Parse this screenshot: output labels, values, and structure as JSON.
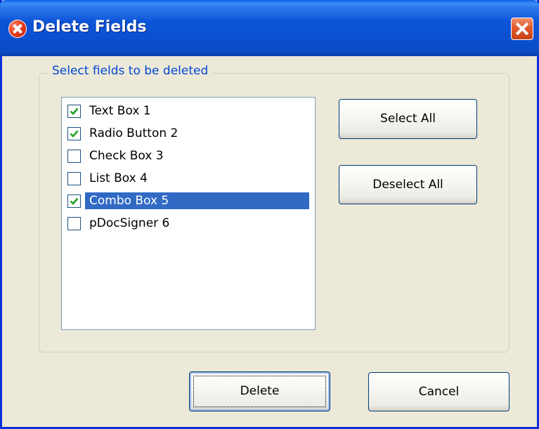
{
  "window": {
    "title": "Delete Fields"
  },
  "group": {
    "legend": "Select fields to be deleted"
  },
  "fields": [
    {
      "label": "Text Box 1",
      "checked": true,
      "selected": false
    },
    {
      "label": "Radio Button 2",
      "checked": true,
      "selected": false
    },
    {
      "label": "Check Box 3",
      "checked": false,
      "selected": false
    },
    {
      "label": "List Box 4",
      "checked": false,
      "selected": false
    },
    {
      "label": "Combo Box 5",
      "checked": true,
      "selected": true
    },
    {
      "label": "pDocSigner 6",
      "checked": false,
      "selected": false
    }
  ],
  "buttons": {
    "select_all": {
      "mnemonic": "S",
      "rest": "elect All"
    },
    "deselect_all": {
      "pre": "D",
      "mnemonic": "e",
      "rest": "select All"
    },
    "delete": {
      "mnemonic": "D",
      "rest": "elete"
    },
    "cancel": {
      "mnemonic": "C",
      "rest": "ancel"
    }
  },
  "colors": {
    "selection": "#316ac5",
    "checkmark": "#21a121",
    "legend_text": "#0046d5"
  },
  "icons": {
    "title": "error-icon",
    "close": "close-icon",
    "check": "checkmark-icon"
  }
}
